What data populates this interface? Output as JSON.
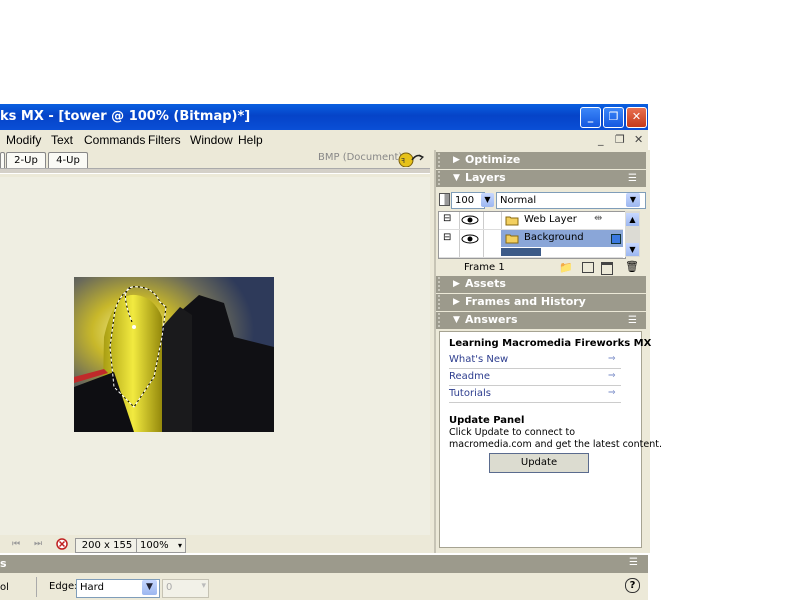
{
  "window": {
    "title": "ks MX - [tower @  100% (Bitmap)*]",
    "buttons": {
      "minimize": "_",
      "restore": "❐",
      "close": "✕"
    }
  },
  "menu": {
    "items": [
      "Modify",
      "Text",
      "Commands",
      "Filters",
      "Window",
      "Help"
    ],
    "mdi": {
      "minimize": "_",
      "restore": "❐",
      "close": "✕"
    }
  },
  "document": {
    "view_tabs": [
      "2-Up",
      "4-Up"
    ],
    "file_type": "BMP (Document)",
    "size": "200 x 155",
    "zoom": "100%"
  },
  "panels": {
    "optimize": "Optimize",
    "layers": "Layers",
    "opacity": "100",
    "blend_mode": "Normal",
    "layer_rows": [
      {
        "name": "Web Layer",
        "toggle": "⊟"
      },
      {
        "name": "Background",
        "toggle": "⊟"
      }
    ],
    "frame": "Frame 1",
    "assets": "Assets",
    "frames_history": "Frames and History",
    "answers": "Answers"
  },
  "answers": {
    "heading": "Learning Macromedia Fireworks MX",
    "links": [
      "What's New",
      "Readme",
      "Tutorials"
    ],
    "update_heading": "Update Panel",
    "update_text_1": "Click Update to connect to",
    "update_text_2": "macromedia.com and get the latest content.",
    "update_button": "Update"
  },
  "property_inspector": {
    "head_text": "s",
    "left_text": "ol",
    "edge_label": "Edge:",
    "edge_value": "Hard",
    "feather_value": "0",
    "help": "?"
  },
  "colors": {
    "title_blue": "#0a4fd6",
    "panel_header": "#9c9a8c",
    "chrome": "#ece9d8",
    "selected_layer": "#8aa6d8"
  }
}
